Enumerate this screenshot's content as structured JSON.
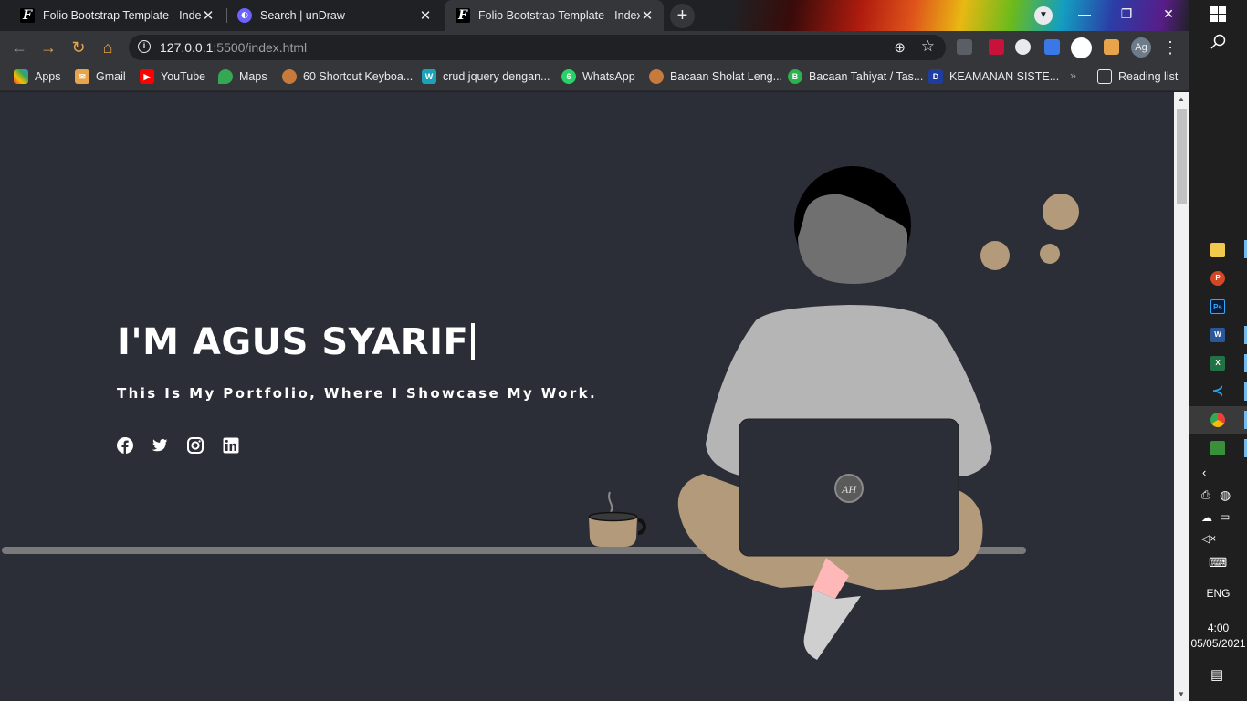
{
  "browser": {
    "tabs": [
      {
        "title": "Folio Bootstrap Template - Index",
        "favicon": "folio-icon",
        "active": false
      },
      {
        "title": "Search | unDraw",
        "favicon": "undraw-icon",
        "active": false
      },
      {
        "title": "Folio Bootstrap Template - Index",
        "favicon": "folio-icon",
        "active": true
      }
    ],
    "url_host": "127.0.0.1",
    "url_rest": ":5500/index.html",
    "profile_initials": "Ag",
    "bookmarks": [
      {
        "label": "Apps",
        "icon": "apps-grid-icon"
      },
      {
        "label": "Gmail",
        "icon": "gmail-icon"
      },
      {
        "label": "YouTube",
        "icon": "youtube-icon"
      },
      {
        "label": "Maps",
        "icon": "maps-icon"
      },
      {
        "label": "60 Shortcut Keyboa...",
        "icon": "globe-icon"
      },
      {
        "label": "crud jquery dengan...",
        "icon": "wr-icon"
      },
      {
        "label": "WhatsApp",
        "icon": "whatsapp-icon"
      },
      {
        "label": "Bacaan Sholat Leng...",
        "icon": "globe-icon"
      },
      {
        "label": "Bacaan Tahiyat / Tas...",
        "icon": "b-icon"
      },
      {
        "label": "KEAMANAN SISTE...",
        "icon": "d-icon"
      }
    ],
    "reading_list": "Reading list"
  },
  "hero": {
    "title": "I'M AGUS SYARIF",
    "subtitle": "This Is My Portfolio, Where I Showcase My Work.",
    "social": [
      "facebook-icon",
      "twitter-icon",
      "instagram-icon",
      "linkedin-icon"
    ],
    "laptop_logo": "AH"
  },
  "taskbar": {
    "language": "ENG",
    "time": "4:00",
    "date": "05/05/2021"
  },
  "colors": {
    "page_bg": "#2b2d37",
    "skin": "#b29a7b",
    "shirt": "#b5b5b5",
    "laptop": "#2b2d37",
    "sock": "#ffb8b8"
  }
}
